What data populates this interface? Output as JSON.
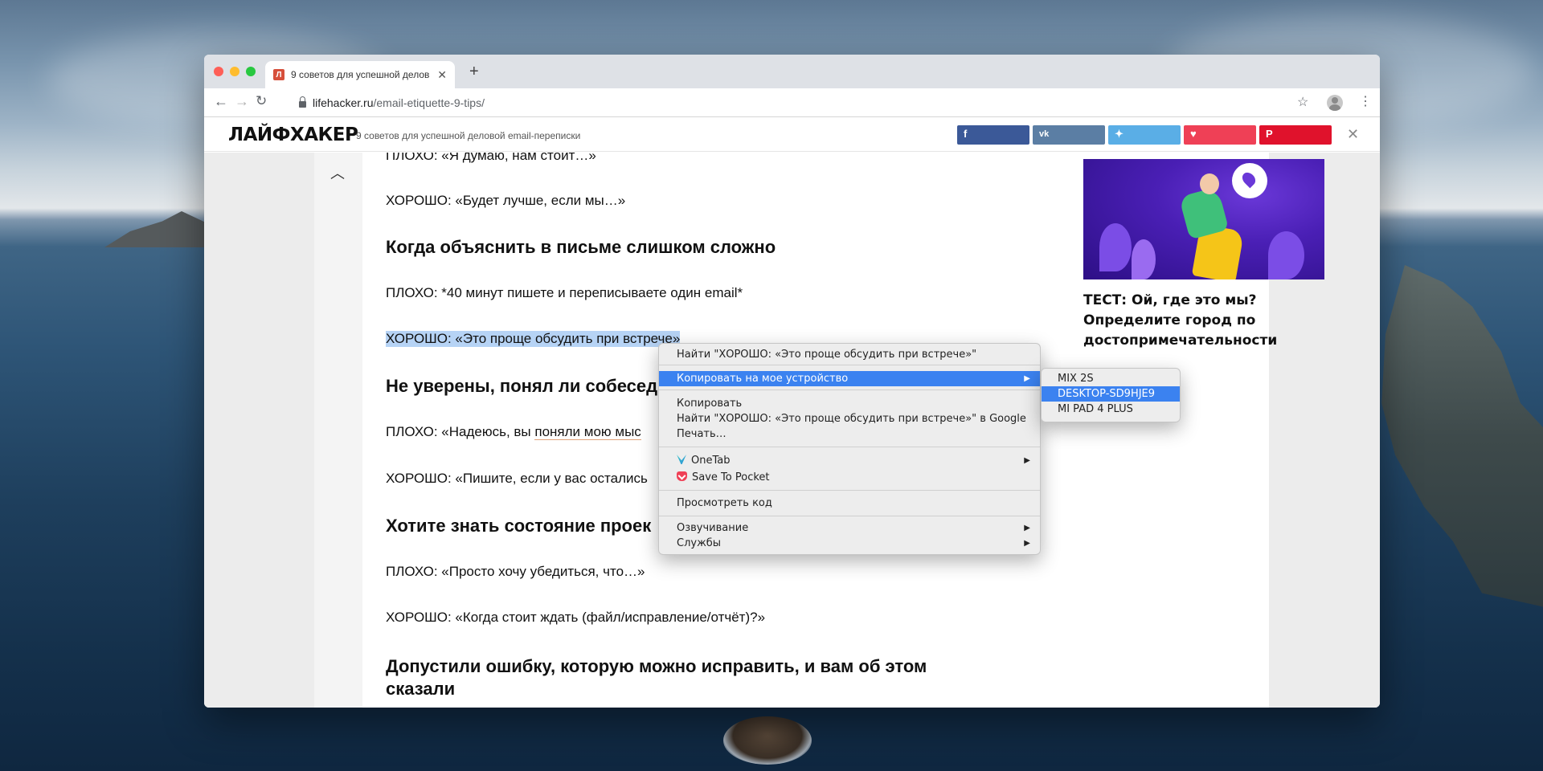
{
  "browser": {
    "tab_title": "9 советов для успешной делов",
    "tab_favicon": "Л",
    "url_host": "lifehacker.ru",
    "url_path": "/email-etiquette-9-tips/"
  },
  "site": {
    "logo": "ЛАЙФХАКЕР",
    "header_title": "9 советов для успешной деловой email-переписки",
    "share_buttons": [
      "facebook-icon",
      "vk-icon",
      "twitter-icon",
      "pocket-icon",
      "pinterest-icon"
    ],
    "share_colors": {
      "facebook": "#3b5998",
      "vk": "#5b7ea4",
      "twitter": "#5aaee6",
      "pocket": "#ef4056",
      "pinterest": "#e0122c"
    }
  },
  "article": {
    "p1": "ПЛОХО: «Я думаю, нам стоит…»",
    "p2": "ХОРОШО: «Будет лучше, если мы…»",
    "h1": "Когда объяснить в письме слишком сложно",
    "p3": "ПЛОХО: *40 минут пишете и переписываете один email*",
    "p4_selected": "ХОРОШО: «Это проще обсудить при встрече»",
    "h2": "Не уверены, понял ли собесед",
    "p5_start": "ПЛОХО: «Надеюсь, вы ",
    "p5_link": "поняли мою мыс",
    "p6": "ХОРОШО: «Пишите, если у вас остались",
    "h3": "Хотите знать состояние проек",
    "p7": "ПЛОХО: «Просто хочу убедиться, что…»",
    "p8": "ХОРОШО: «Когда стоит ждать (файл/исправление/отчёт)?»",
    "h4": "Допустили ошибку, которую можно исправить, и вам об этом сказали"
  },
  "sidebar": {
    "caption": "ТЕСТ: Ой, где это мы? Определите город по достопримечательности"
  },
  "context_menu": {
    "find_selection": "Найти \"ХОРОШО: «Это проще обсудить при встрече»\"",
    "copy_to_device": "Копировать на мое устройство",
    "copy": "Копировать",
    "search_google": "Найти \"ХОРОШО: «Это проще обсудить при встрече»\" в Google",
    "print": "Печать…",
    "onetab": "OneTab",
    "save_pocket": "Save To Pocket",
    "inspect": "Просмотреть код",
    "speech": "Озвучивание",
    "services": "Службы"
  },
  "devices_submenu": {
    "items": [
      "MIX 2S",
      "DESKTOP-SD9HJE9",
      "MI PAD 4 PLUS"
    ],
    "selected_index": 1
  }
}
